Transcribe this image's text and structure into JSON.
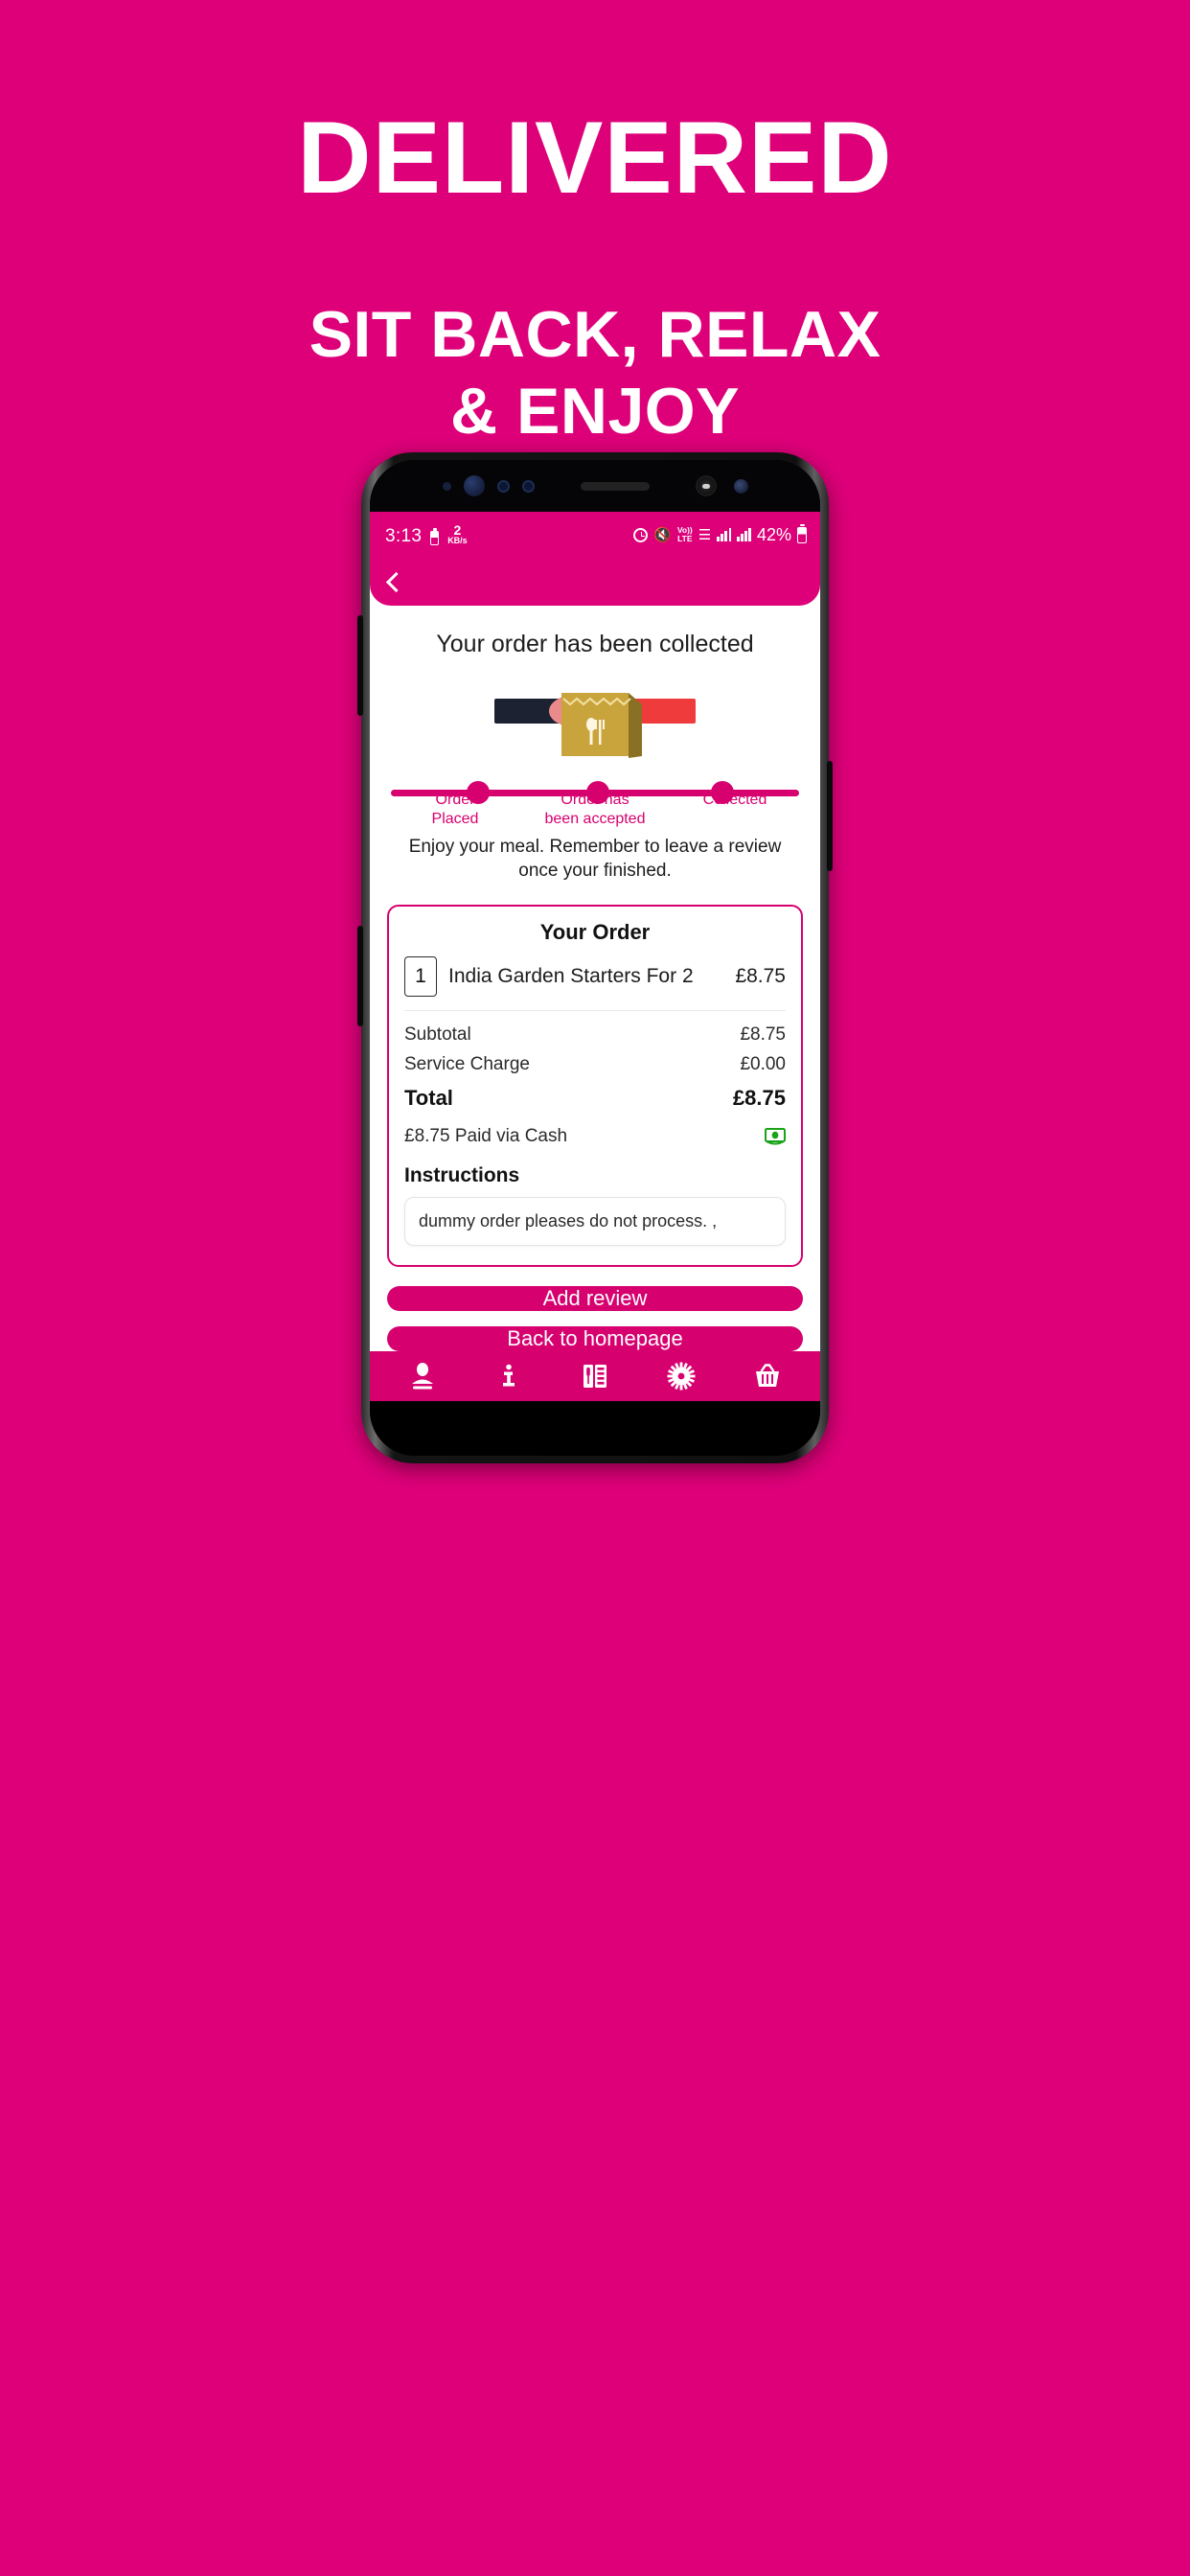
{
  "hero": {
    "title": "DELIVERED",
    "subtitle_line1": "SIT BACK, RELAX",
    "subtitle_line2": "& ENJOY",
    "background_color": "#de0079",
    "text_color": "#ffffff"
  },
  "status_bar": {
    "time": "3:13",
    "network_speed_value": "2",
    "network_speed_unit": "KB/s",
    "alarm_icon": "alarm-icon",
    "mute_icon": "vibrate-mute-icon",
    "volte_label_top": "Vo))",
    "volte_label_bottom": "LTE",
    "wifi_icon": "wifi-icon",
    "signal_icon": "signal-bars-icon",
    "battery_percent": "42%",
    "battery_icon": "battery-icon"
  },
  "app_bar": {
    "back_icon": "back-chevron-icon"
  },
  "screen": {
    "heading": "Your order has been collected",
    "illustration": "handover-food-bag-illustration",
    "hint": "Enjoy your meal. Remember to leave a review once your finished."
  },
  "tracker": {
    "steps": [
      {
        "label_line1": "Order",
        "label_line2": "Placed",
        "done": true
      },
      {
        "label_line1": "Order has",
        "label_line2": "been accepted",
        "done": true
      },
      {
        "label_line1": "Collected",
        "label_line2": "",
        "done": true
      }
    ],
    "accent_color": "#d6006f"
  },
  "order_card": {
    "title": "Your Order",
    "items": [
      {
        "qty": "1",
        "name": "India Garden Starters For 2",
        "price": "£8.75"
      }
    ],
    "summary": [
      {
        "label": "Subtotal",
        "value": "£8.75"
      },
      {
        "label": "Service Charge",
        "value": "£0.00"
      }
    ],
    "total_label": "Total",
    "total_value": "£8.75",
    "paid_text": "£8.75 Paid via Cash",
    "paid_icon": "cash-banknote-icon",
    "instructions_label": "Instructions",
    "instructions_value": "dummy order pleases do not process. ,",
    "border_color": "#d6006f"
  },
  "actions": {
    "add_review": "Add review",
    "back_to_homepage": "Back to homepage"
  },
  "bottom_nav": {
    "items": [
      {
        "icon": "account-person-icon",
        "name": "account"
      },
      {
        "icon": "info-icon",
        "name": "info"
      },
      {
        "icon": "menu-cutlery-icon",
        "name": "menu"
      },
      {
        "icon": "settings-gear-icon",
        "name": "settings"
      },
      {
        "icon": "basket-icon",
        "name": "basket"
      }
    ],
    "background_color": "#d6006f"
  }
}
